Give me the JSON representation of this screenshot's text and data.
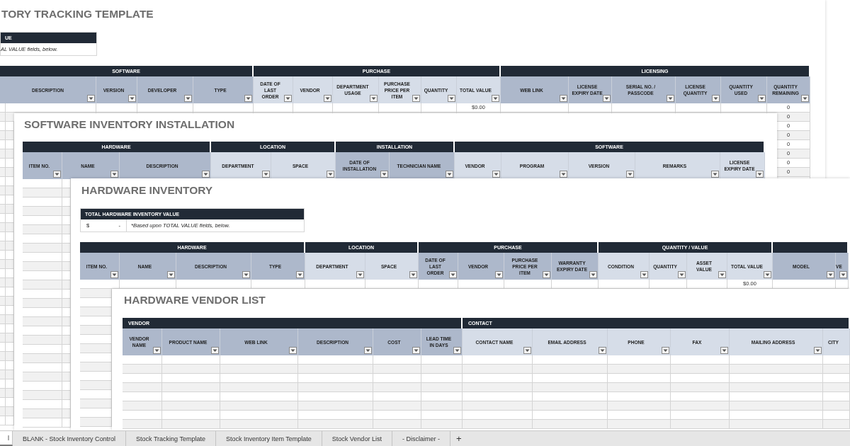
{
  "sheets": [
    {
      "title": "TORY TRACKING TEMPLATE",
      "summary": {
        "header": "UE",
        "cells": [
          {
            "kind": "note",
            "text": "AL VALUE fields, below."
          }
        ]
      },
      "groups": [
        {
          "label": "SOFTWARE",
          "shaded": true,
          "columns": [
            {
              "label": "DESCRIPTION"
            },
            {
              "label": "VERSION"
            },
            {
              "label": "DEVELOPER"
            },
            {
              "label": "TYPE"
            }
          ]
        },
        {
          "label": "PURCHASE",
          "shaded": false,
          "columns": [
            {
              "label": "DATE OF LAST ORDER"
            },
            {
              "label": "VENDOR"
            },
            {
              "label": "DEPARTMENT USAGE"
            },
            {
              "label": "PURCHASE PRICE PER ITEM"
            },
            {
              "label": "QUANTITY"
            },
            {
              "label": "TOTAL VALUE",
              "values": [
                "$0.00"
              ]
            }
          ]
        },
        {
          "label": "LICENSING",
          "shaded": true,
          "columns": [
            {
              "label": "WEB LINK"
            },
            {
              "label": "LICENSE EXPIRY DATE"
            },
            {
              "label": "SERIAL NO. / PASSCODE"
            },
            {
              "label": "LICENSE QUANTITY"
            },
            {
              "label": "QUANTITY USED"
            },
            {
              "label": "QUANTITY REMAINING",
              "values": [
                "0",
                "0",
                "0",
                "0",
                "0",
                "0",
                "0",
                "0"
              ]
            }
          ]
        }
      ]
    },
    {
      "title": "SOFTWARE INVENTORY INSTALLATION",
      "groups": [
        {
          "label": "HARDWARE",
          "shaded": true,
          "columns": [
            {
              "label": "ITEM NO."
            },
            {
              "label": "NAME"
            },
            {
              "label": "DESCRIPTION"
            }
          ]
        },
        {
          "label": "LOCATION",
          "shaded": false,
          "columns": [
            {
              "label": "DEPARTMENT"
            },
            {
              "label": "SPACE"
            }
          ]
        },
        {
          "label": "INSTALLATION",
          "shaded": true,
          "columns": [
            {
              "label": "DATE OF INSTALLATION"
            },
            {
              "label": "TECHNICIAN NAME"
            }
          ]
        },
        {
          "label": "SOFTWARE",
          "shaded": false,
          "columns": [
            {
              "label": "VENDOR"
            },
            {
              "label": "PROGRAM"
            },
            {
              "label": "VERSION"
            },
            {
              "label": "REMARKS"
            },
            {
              "label": "LICENSE EXPIRY DATE"
            }
          ]
        }
      ]
    },
    {
      "title": "HARDWARE INVENTORY",
      "summary": {
        "header": "TOTAL HARDWARE INVENTORY VALUE",
        "cells": [
          {
            "kind": "currency",
            "text": "$"
          },
          {
            "kind": "amount",
            "text": "-"
          },
          {
            "kind": "note",
            "text": "*Based upon TOTAL VALUE fields, below."
          }
        ]
      },
      "groups": [
        {
          "label": "HARDWARE",
          "shaded": true,
          "columns": [
            {
              "label": "ITEM NO."
            },
            {
              "label": "NAME"
            },
            {
              "label": "DESCRIPTION"
            },
            {
              "label": "TYPE"
            }
          ]
        },
        {
          "label": "LOCATION",
          "shaded": false,
          "columns": [
            {
              "label": "DEPARTMENT"
            },
            {
              "label": "SPACE"
            }
          ]
        },
        {
          "label": "PURCHASE",
          "shaded": true,
          "columns": [
            {
              "label": "DATE OF LAST ORDER"
            },
            {
              "label": "VENDOR"
            },
            {
              "label": "PURCHASE PRICE PER ITEM"
            },
            {
              "label": "WARRANTY EXPIRY DATE"
            }
          ]
        },
        {
          "label": "QUANTITY / VALUE",
          "shaded": false,
          "columns": [
            {
              "label": "CONDITION"
            },
            {
              "label": "QUANTITY"
            },
            {
              "label": "ASSET VALUE"
            },
            {
              "label": "TOTAL VALUE",
              "values": [
                "$0.00"
              ]
            }
          ]
        },
        {
          "shaded": true,
          "columns": [
            {
              "label": "MODEL"
            },
            {
              "label": "VE"
            }
          ]
        }
      ]
    },
    {
      "title": "HARDWARE VENDOR LIST",
      "groups": [
        {
          "label": "VENDOR",
          "shaded": true,
          "columns": [
            {
              "label": "VENDOR NAME"
            },
            {
              "label": "PRODUCT NAME"
            },
            {
              "label": "WEB LINK"
            },
            {
              "label": "DESCRIPTION"
            },
            {
              "label": "COST"
            },
            {
              "label": "LEAD TIME IN DAYS"
            }
          ]
        },
        {
          "label": "CONTACT",
          "shaded": false,
          "columns": [
            {
              "label": "CONTACT NAME"
            },
            {
              "label": "EMAIL ADDRESS"
            },
            {
              "label": "PHONE"
            },
            {
              "label": "FAX"
            },
            {
              "label": "MAILING ADDRESS"
            },
            {
              "label": "CITY"
            }
          ]
        }
      ]
    }
  ],
  "tabs": [
    {
      "label": "l",
      "selected": true
    },
    {
      "label": "BLANK - Stock Inventory Control",
      "selected": false
    },
    {
      "label": "Stock Tracking Template",
      "selected": false
    },
    {
      "label": "Stock Inventory Item Template",
      "selected": false
    },
    {
      "label": "Stock Vendor List",
      "selected": false
    },
    {
      "label": "- Disclaimer -",
      "selected": false
    }
  ],
  "add_tab": "+"
}
